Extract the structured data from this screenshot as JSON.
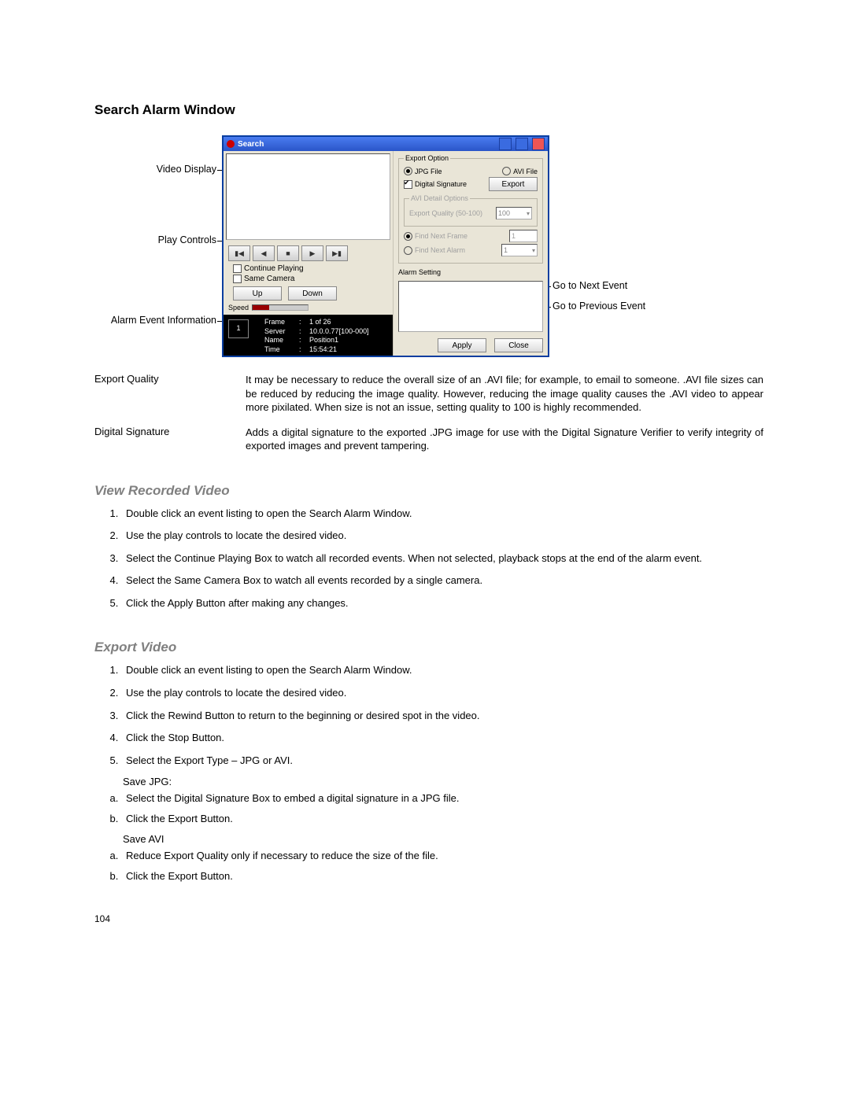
{
  "title": "Search Alarm Window",
  "callouts": {
    "video_display": "Video Display",
    "play_controls": "Play Controls",
    "alarm_event_info": "Alarm Event Information",
    "go_next": "Go to Next Event",
    "go_prev": "Go to Previous Event"
  },
  "window": {
    "title": "Search",
    "export_option_legend": "Export Option",
    "jpg_file": "JPG File",
    "avi_file": "AVI File",
    "digital_signature": "Digital Signature",
    "export_btn": "Export",
    "avi_detail_legend": "AVI Detail Options",
    "export_quality_lbl": "Export Quality (50-100)",
    "export_quality_val": "100",
    "find_next_frame": "Find Next Frame",
    "find_next_alarm": "Find Next Alarm",
    "find_val1": "1",
    "find_val2": "1",
    "alarm_setting": "Alarm Setting",
    "continue_playing": "Continue Playing",
    "same_camera": "Same Camera",
    "up_btn": "Up",
    "down_btn": "Down",
    "speed_lbl": "Speed",
    "apply_btn": "Apply",
    "close_btn": "Close",
    "info": {
      "thumb": "1",
      "time_small": "15:54:21",
      "frame_lab": "Frame",
      "frame_val": "1 of 26",
      "server_lab": "Server",
      "server_val": "10.0.0.77[100-000]",
      "name_lab": "Name",
      "name_val": "Position1",
      "time_lab": "Time",
      "time_val": "15:54:21"
    }
  },
  "defs": {
    "export_quality_term": "Export Quality",
    "export_quality_desc": "It may be necessary to reduce the overall size of an .AVI file; for example, to email to someone. .AVI file sizes can be reduced by reducing the image quality.  However, reducing the image quality causes the .AVI video to appear more pixilated.  When size is not an issue, setting quality to 100 is highly recommended.",
    "digital_sig_term": "Digital Signature",
    "digital_sig_desc": "Adds a digital signature to the exported .JPG image for use with the Digital Signature Verifier to verify integrity of exported images and prevent tampering."
  },
  "view_title": "View Recorded Video",
  "view_steps": [
    "Double click an event listing to open the Search Alarm Window.",
    "Use the play controls to locate the desired video.",
    "Select the Continue Playing Box to watch all recorded events.  When not selected, playback stops at the end of the alarm event.",
    "Select the Same Camera Box to watch all events recorded by a single camera.",
    "Click the Apply Button after making any changes."
  ],
  "export_title": "Export Video",
  "export_steps": [
    "Double click an event listing to open the Search Alarm Window.",
    "Use the play controls to locate the desired video.",
    "Click the Rewind Button to return to the beginning or desired spot in the video.",
    "Click the Stop Button.",
    "Select the Export Type – JPG or AVI."
  ],
  "save_jpg_label": "Save JPG:",
  "save_jpg_steps": [
    "Select the Digital Signature Box to embed a digital signature in a JPG file.",
    "Click the Export Button."
  ],
  "save_avi_label": "Save AVI",
  "save_avi_steps": [
    "Reduce Export Quality only if necessary to reduce the size of the file.",
    "Click the Export Button."
  ],
  "page_num": "104"
}
